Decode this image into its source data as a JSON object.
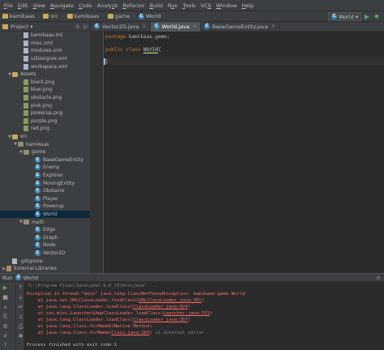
{
  "menu": [
    {
      "label": "File",
      "u": "F"
    },
    {
      "label": "Edit",
      "u": "E"
    },
    {
      "label": "View",
      "u": "V"
    },
    {
      "label": "Navigate",
      "u": "N"
    },
    {
      "label": "Code",
      "u": "C"
    },
    {
      "label": "Analyze",
      "u": "z"
    },
    {
      "label": "Refactor",
      "u": "R"
    },
    {
      "label": "Build",
      "u": "B"
    },
    {
      "label": "Run",
      "u": "u"
    },
    {
      "label": "Tools",
      "u": "T"
    },
    {
      "label": "VCS",
      "u": "S"
    },
    {
      "label": "Window",
      "u": "W"
    },
    {
      "label": "Help",
      "u": "H"
    }
  ],
  "breadcrumbs": [
    "kamikaas",
    "src",
    "kamikaas",
    "game",
    "World"
  ],
  "run_config": "World",
  "project_panel": {
    "label": "Project",
    "dropdown": "▾"
  },
  "tree": [
    {
      "label": "kamikaas.iml",
      "depth": 3,
      "icon": "file",
      "tri": ""
    },
    {
      "label": "misc.xml",
      "depth": 3,
      "icon": "file",
      "tri": ""
    },
    {
      "label": "modules.xml",
      "depth": 3,
      "icon": "file",
      "tri": ""
    },
    {
      "label": "uiDesigner.xml",
      "depth": 3,
      "icon": "file",
      "tri": ""
    },
    {
      "label": "workspace.xml",
      "depth": 3,
      "icon": "file",
      "tri": ""
    },
    {
      "label": "Assets",
      "depth": 1,
      "icon": "dir",
      "tri": "▼"
    },
    {
      "label": "black.png",
      "depth": 3,
      "icon": "img",
      "tri": ""
    },
    {
      "label": "blue.png",
      "depth": 3,
      "icon": "img",
      "tri": ""
    },
    {
      "label": "obstacle.png",
      "depth": 3,
      "icon": "img",
      "tri": ""
    },
    {
      "label": "pink.png",
      "depth": 3,
      "icon": "img",
      "tri": ""
    },
    {
      "label": "powerup.png",
      "depth": 3,
      "icon": "img",
      "tri": ""
    },
    {
      "label": "purple.png",
      "depth": 3,
      "icon": "img",
      "tri": ""
    },
    {
      "label": "red.png",
      "depth": 3,
      "icon": "img",
      "tri": ""
    },
    {
      "label": "src",
      "depth": 1,
      "icon": "dir",
      "tri": "▼"
    },
    {
      "label": "kamikaas",
      "depth": 2,
      "icon": "pkg",
      "tri": "▼"
    },
    {
      "label": "game",
      "depth": 3,
      "icon": "pkg",
      "tri": "▼"
    },
    {
      "label": "BaseGameEntity",
      "depth": 5,
      "icon": "class",
      "tri": ""
    },
    {
      "label": "Enemy",
      "depth": 5,
      "icon": "class",
      "tri": ""
    },
    {
      "label": "Explorer",
      "depth": 5,
      "icon": "class",
      "tri": ""
    },
    {
      "label": "MovingEntity",
      "depth": 5,
      "icon": "class",
      "tri": ""
    },
    {
      "label": "Obstacle",
      "depth": 5,
      "icon": "class",
      "tri": ""
    },
    {
      "label": "Player",
      "depth": 5,
      "icon": "class",
      "tri": ""
    },
    {
      "label": "Powerup",
      "depth": 5,
      "icon": "class",
      "tri": ""
    },
    {
      "label": "World",
      "depth": 5,
      "icon": "class",
      "tri": "",
      "selected": true
    },
    {
      "label": "math",
      "depth": 3,
      "icon": "pkg",
      "tri": "▼"
    },
    {
      "label": "Edge",
      "depth": 5,
      "icon": "class",
      "tri": ""
    },
    {
      "label": "Graph",
      "depth": 5,
      "icon": "class",
      "tri": ""
    },
    {
      "label": "Node",
      "depth": 5,
      "icon": "class",
      "tri": ""
    },
    {
      "label": "Vector2D",
      "depth": 5,
      "icon": "class",
      "tri": ""
    },
    {
      "label": ".gitignore",
      "depth": 1,
      "icon": "file",
      "tri": ""
    },
    {
      "label": "External Libraries",
      "depth": 0,
      "icon": "lib",
      "tri": "▶"
    }
  ],
  "editor_tabs": [
    {
      "label": "Vector2D.java",
      "active": false
    },
    {
      "label": "World.java",
      "active": true
    },
    {
      "label": "BaseGameEntity.java",
      "active": false
    }
  ],
  "code": {
    "line1_kw": "package",
    "line1_rest": " kamikaas.game;",
    "line2_kw1": "public",
    "line2_kw2": " class",
    "line2_name": "World",
    "line2_brace": "{",
    "line3": "}"
  },
  "run_panel": {
    "label": "Run",
    "config": "World"
  },
  "console": {
    "cmd": "\"C:\\Program Files\\Java\\jdk1.8.0_73\\bin\\java\" ...",
    "exc": "Exception in thread \"main\" java.lang.ClassNotFoundException: kamikaas.game.World",
    "frames": [
      {
        "pre": "    at java.net.URLClassLoader.findClass(",
        "link": "URLClassLoader.java:381",
        "post": ")"
      },
      {
        "pre": "    at java.lang.ClassLoader.loadClass(",
        "link": "ClassLoader.java:424",
        "post": ")"
      },
      {
        "pre": "    at sun.misc.Launcher$AppClassLoader.loadClass(",
        "link": "Launcher.java:331",
        "post": ")"
      },
      {
        "pre": "    at java.lang.ClassLoader.loadClass(",
        "link": "ClassLoader.java:357",
        "post": ")"
      },
      {
        "pre": "    at java.lang.Class.forName0(Native Method)",
        "link": "",
        "post": ""
      },
      {
        "pre": "    at java.lang.Class.forName(",
        "link": "Class.java:264",
        "post": ")",
        "note": " <1 internal calls>"
      }
    ],
    "exit": "Process finished with exit code 1"
  },
  "colors": {
    "accent_selection": "#0d293e",
    "keyword": "#cc7832",
    "error": "#ff6b68",
    "run_green": "#59a869"
  }
}
